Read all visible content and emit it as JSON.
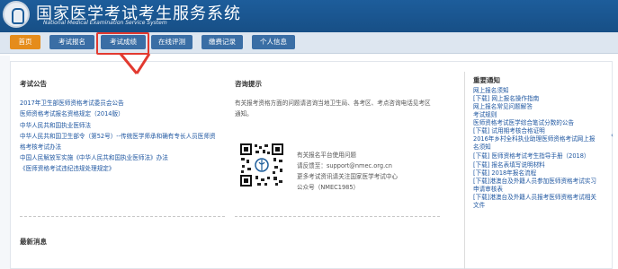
{
  "header": {
    "title": "国家医学考试考生服务系统",
    "subtitle": "National Medical Examination Service System"
  },
  "nav": {
    "items": [
      {
        "label": "首页",
        "active": true
      },
      {
        "label": "考试报名",
        "active": false
      },
      {
        "label": "考试成绩",
        "active": false
      },
      {
        "label": "在线评测",
        "active": false
      },
      {
        "label": "缴费记录",
        "active": false
      },
      {
        "label": "个人信息",
        "active": false
      }
    ],
    "highlighted": "考试成绩"
  },
  "announcements": {
    "title": "考试公告",
    "items": [
      "2017年卫生部医师资格考试委员会公告",
      "医师资格考试报名资格规定（2014版）",
      "中华人民共和国执业医师法",
      "中华人民共和国卫生部令（第52号）--传统医学师承和确有专长人员医师资",
      "格考核考试办法",
      "中国人民解放军实施《中华人民共和国执业医师法》办法",
      "《医师资格考试违纪违规处理规定》"
    ]
  },
  "consult": {
    "title": "咨询提示",
    "lines": [
      "有关报考资格方面的问题请咨询当地卫生局、各考区、考点咨询电话见考区",
      "通知。"
    ],
    "contact": [
      "有关报名平台使用问题",
      "请反馈至：support@nmec.org.cn",
      "更多考试资讯请关注国家医学考试中心",
      "公众号（NMEC1985）"
    ]
  },
  "news": {
    "title": "最新消息"
  },
  "important": {
    "title": "重要通知",
    "items": [
      "网上报名须知",
      "[下载] 网上报名操作指南",
      "网上报名常见问题解答",
      "考试规则",
      "医师资格考试医学综合笔试分数的公告",
      "[下载] 试用期考核合格证明",
      "2016年乡村全科执业助理医师资格考试网上报",
      "名须知",
      "[下载] 医师资格考试考生指导手册（2018）",
      "[下载] 报名表填写说明材料",
      "[下载] 2018年报名流程",
      "[下载]港澳台及外籍人员参加医师资格考试实习",
      "申请审核表",
      "[下载]港澳台及外籍人员报考医师资格考试相关",
      "文件"
    ]
  },
  "colors": {
    "header": "#1d5d9b",
    "nav_active": "#e58c1b",
    "nav_item": "#3a6ea5",
    "highlight": "#e23a30",
    "link": "#1e56a0"
  }
}
